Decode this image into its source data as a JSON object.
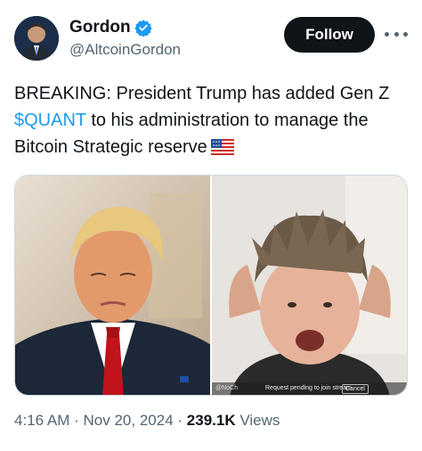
{
  "author": {
    "display_name": "Gordon",
    "handle": "@AltcoinGordon",
    "verified": true
  },
  "actions": {
    "follow_label": "Follow",
    "more_icon": "more-horizontal-icon"
  },
  "tweet": {
    "text_part1": "BREAKING: President Trump has added Gen Z ",
    "cashtag": "$QUANT",
    "text_part2": " to his administration to manage the Bitcoin Strategic reserve",
    "emoji": "us-flag-icon"
  },
  "media": {
    "right_image_overlay": {
      "watermark": "@NoCh",
      "request_text": "Request pending to join stream",
      "cancel_label": "Cancel"
    }
  },
  "meta": {
    "time": "4:16 AM",
    "separator": "·",
    "date": "Nov 20, 2024",
    "views_count": "239.1K",
    "views_label": "Views"
  },
  "colors": {
    "accent": "#1d9bf0",
    "text": "#0f1419",
    "muted": "#536471",
    "button_bg": "#0f1419"
  }
}
